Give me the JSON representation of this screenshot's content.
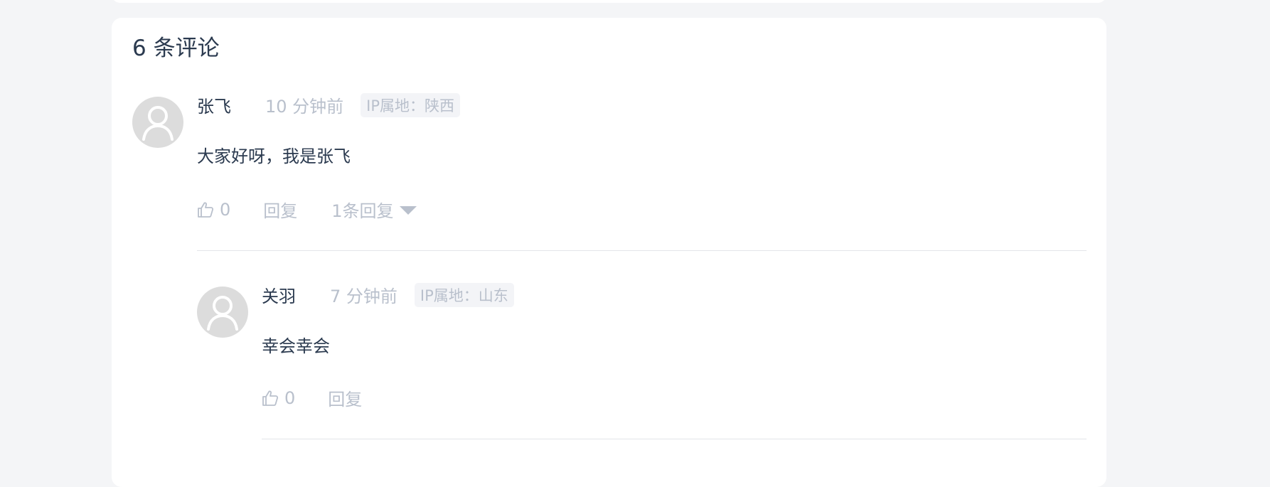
{
  "comments_header": {
    "title": "6 条评论"
  },
  "comments": [
    {
      "author": "张飞",
      "time": "10 分钟前",
      "ip": "IP属地：陕西",
      "content": "大家好呀，我是张飞",
      "likes": "0",
      "reply_label": "回复",
      "replies_toggle_label": "1条回复"
    },
    {
      "author": "关羽",
      "time": "7 分钟前",
      "ip": "IP属地：山东",
      "content": "幸会幸会",
      "likes": "0",
      "reply_label": "回复"
    }
  ],
  "colors": {
    "text_primary": "#2b3a4f",
    "text_muted": "#b9c0cc",
    "avatar_bg": "#dcdcdc",
    "page_bg": "#f4f5f7"
  },
  "icons": [
    "user-avatar-icon",
    "thumbs-up-icon",
    "caret-down-icon"
  ]
}
